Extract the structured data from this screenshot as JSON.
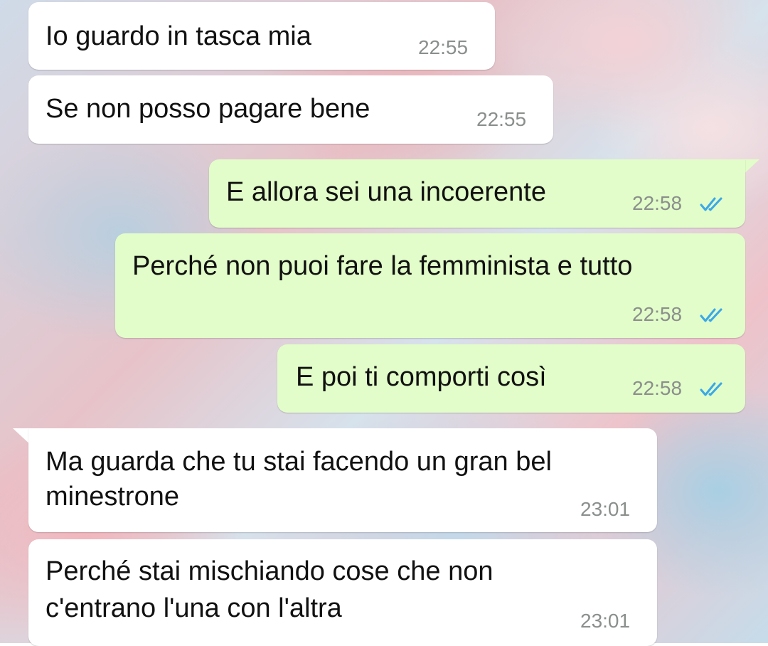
{
  "theme": {
    "incoming_bubble": "#ffffff",
    "outgoing_bubble": "#e2fdc9",
    "read_tick_color": "#3aa8e8",
    "time_color": "#8a8f8c"
  },
  "messages": [
    {
      "direction": "in",
      "lines": [
        "Io guardo in tasca mia"
      ],
      "time": "22:55"
    },
    {
      "direction": "in",
      "lines": [
        "Se non posso pagare bene"
      ],
      "time": "22:55"
    },
    {
      "direction": "out",
      "lines": [
        "E allora sei una incoerente"
      ],
      "time": "22:58",
      "status": "read-ticks-icon"
    },
    {
      "direction": "out",
      "lines": [
        "Perché non puoi fare la femminista e tutto"
      ],
      "time": "22:58",
      "status": "read-ticks-icon"
    },
    {
      "direction": "out",
      "lines": [
        "E poi ti comporti così"
      ],
      "time": "22:58",
      "status": "read-ticks-icon"
    },
    {
      "direction": "in",
      "lines": [
        "Ma guarda che tu stai facendo un gran bel",
        "minestrone"
      ],
      "time": "23:01"
    },
    {
      "direction": "in",
      "lines": [
        "Perché stai mischiando cose che non",
        "c'entrano l'una con l'altra"
      ],
      "time": "23:01"
    }
  ]
}
